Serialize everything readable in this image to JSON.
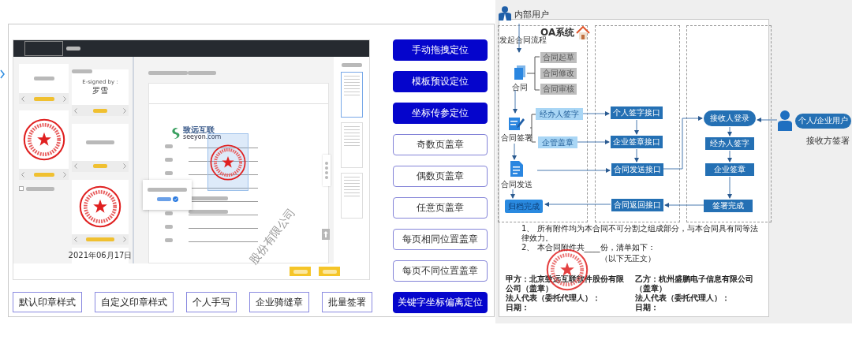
{
  "app_screenshot": {
    "signature_caption": "E-signed by :",
    "signer": "罗雪",
    "date": "2021年06月17日",
    "logo_name": "致远互联",
    "logo_domain": "seeyon.com",
    "watermark": "股份有限公司",
    "stamp_checkbox": {
      "checked": false
    }
  },
  "position_buttons": [
    {
      "label": "手动拖拽定位",
      "kind": "filled"
    },
    {
      "label": "模板预设定位",
      "kind": "filled"
    },
    {
      "label": "坐标传参定位",
      "kind": "filled"
    },
    {
      "label": "奇数页盖章",
      "kind": "outline"
    },
    {
      "label": "偶数页盖章",
      "kind": "outline"
    },
    {
      "label": "任意页盖章",
      "kind": "outline"
    },
    {
      "label": "每页相同位置盖章",
      "kind": "outline"
    },
    {
      "label": "每页不同位置盖章",
      "kind": "outline"
    },
    {
      "label": "关键字坐标偏离定位",
      "kind": "filled"
    }
  ],
  "style_buttons": [
    "默认印章样式",
    "自定义印章样式",
    "个人手写",
    "企业骑缝章",
    "批量签署"
  ],
  "flow": {
    "actor": "内部用户",
    "system": "OA系统",
    "start": "发起合同流程",
    "nodes": [
      {
        "label": "合同",
        "kind": "doc"
      },
      {
        "label": "合同起草",
        "kind": "gray"
      },
      {
        "label": "合同修改",
        "kind": "gray"
      },
      {
        "label": "合同审核",
        "kind": "gray"
      },
      {
        "label": "合同签署",
        "kind": "sign"
      },
      {
        "label": "经办人签字",
        "kind": "light"
      },
      {
        "label": "企管盖章",
        "kind": "light"
      },
      {
        "label": "合同发送",
        "kind": "send"
      },
      {
        "label": "归档完成",
        "kind": "archive"
      },
      {
        "label": "个人签字接口",
        "kind": "dark"
      },
      {
        "label": "企业签章接口",
        "kind": "dark"
      },
      {
        "label": "合同发送接口",
        "kind": "dark"
      },
      {
        "label": "合同返回接口",
        "kind": "dark"
      },
      {
        "label": "接收人登录",
        "kind": "pill"
      },
      {
        "label": "经办人签字",
        "kind": "dark"
      },
      {
        "label": "企业签章",
        "kind": "dark"
      },
      {
        "label": "签署完成",
        "kind": "dark"
      }
    ],
    "receiver": "个人/企业用户",
    "receiver_caption": "接收方签署"
  },
  "document": {
    "clauses": [
      "1、 所有附件均为本合同不可分割之组成部分，与本合同具有同等法律效力。",
      "2、 本合同附件共____份，清单如下："
    ],
    "end_note": "（以下无正文）",
    "parties": [
      {
        "name": "甲方：北京致远互联软件股份有限公司（盖章）",
        "representative": "法人代表（委托代理人）：",
        "date": "日期："
      },
      {
        "name": "乙方：杭州盛鹏电子信息有限公司（盖章）",
        "representative": "法人代表（委托代理人）：",
        "date": "日期："
      }
    ]
  }
}
